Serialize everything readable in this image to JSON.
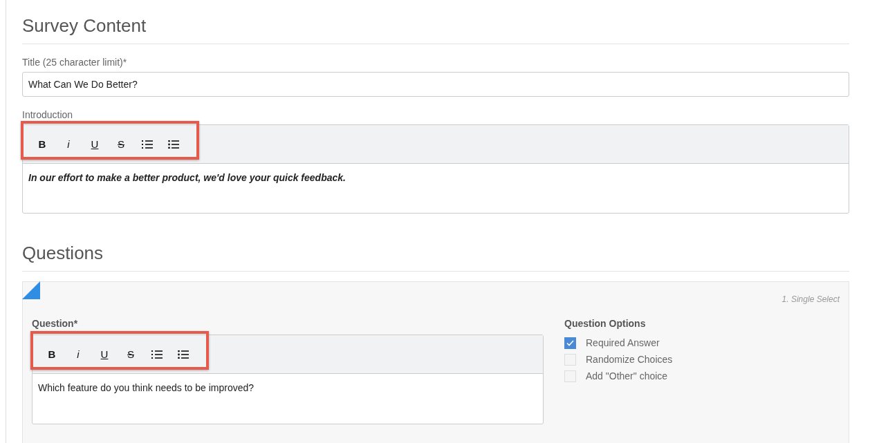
{
  "survey_content": {
    "heading": "Survey Content",
    "title_field": {
      "label": "Title (25 character limit)*",
      "value": "What Can We Do Better?"
    },
    "introduction": {
      "label": "Introduction",
      "toolbar": {
        "highlighted": true,
        "buttons": [
          {
            "kind": "bold",
            "label": "B"
          },
          {
            "kind": "italic",
            "label": "i"
          },
          {
            "kind": "underline",
            "label": "U"
          },
          {
            "kind": "strike",
            "label": "S"
          },
          {
            "kind": "ordered-list"
          },
          {
            "kind": "bullet-list"
          }
        ]
      },
      "value": "In our effort to make a better product, we'd love your quick feedback."
    }
  },
  "questions": {
    "heading": "Questions",
    "question": {
      "type_label": "1. Single Select",
      "label": "Question*",
      "editor": {
        "toolbar": {
          "highlighted": true,
          "buttons": [
            {
              "kind": "bold",
              "label": "B"
            },
            {
              "kind": "italic",
              "label": "i"
            },
            {
              "kind": "underline",
              "label": "U"
            },
            {
              "kind": "strike",
              "label": "S"
            },
            {
              "kind": "ordered-list"
            },
            {
              "kind": "bullet-list"
            }
          ]
        },
        "value": "Which feature do you think needs to be improved?"
      },
      "options": {
        "heading": "Question Options",
        "items": [
          {
            "label": "Required Answer",
            "checked": true
          },
          {
            "label": "Randomize Choices",
            "checked": false
          },
          {
            "label": "Add \"Other\" choice",
            "checked": false
          }
        ]
      }
    }
  }
}
